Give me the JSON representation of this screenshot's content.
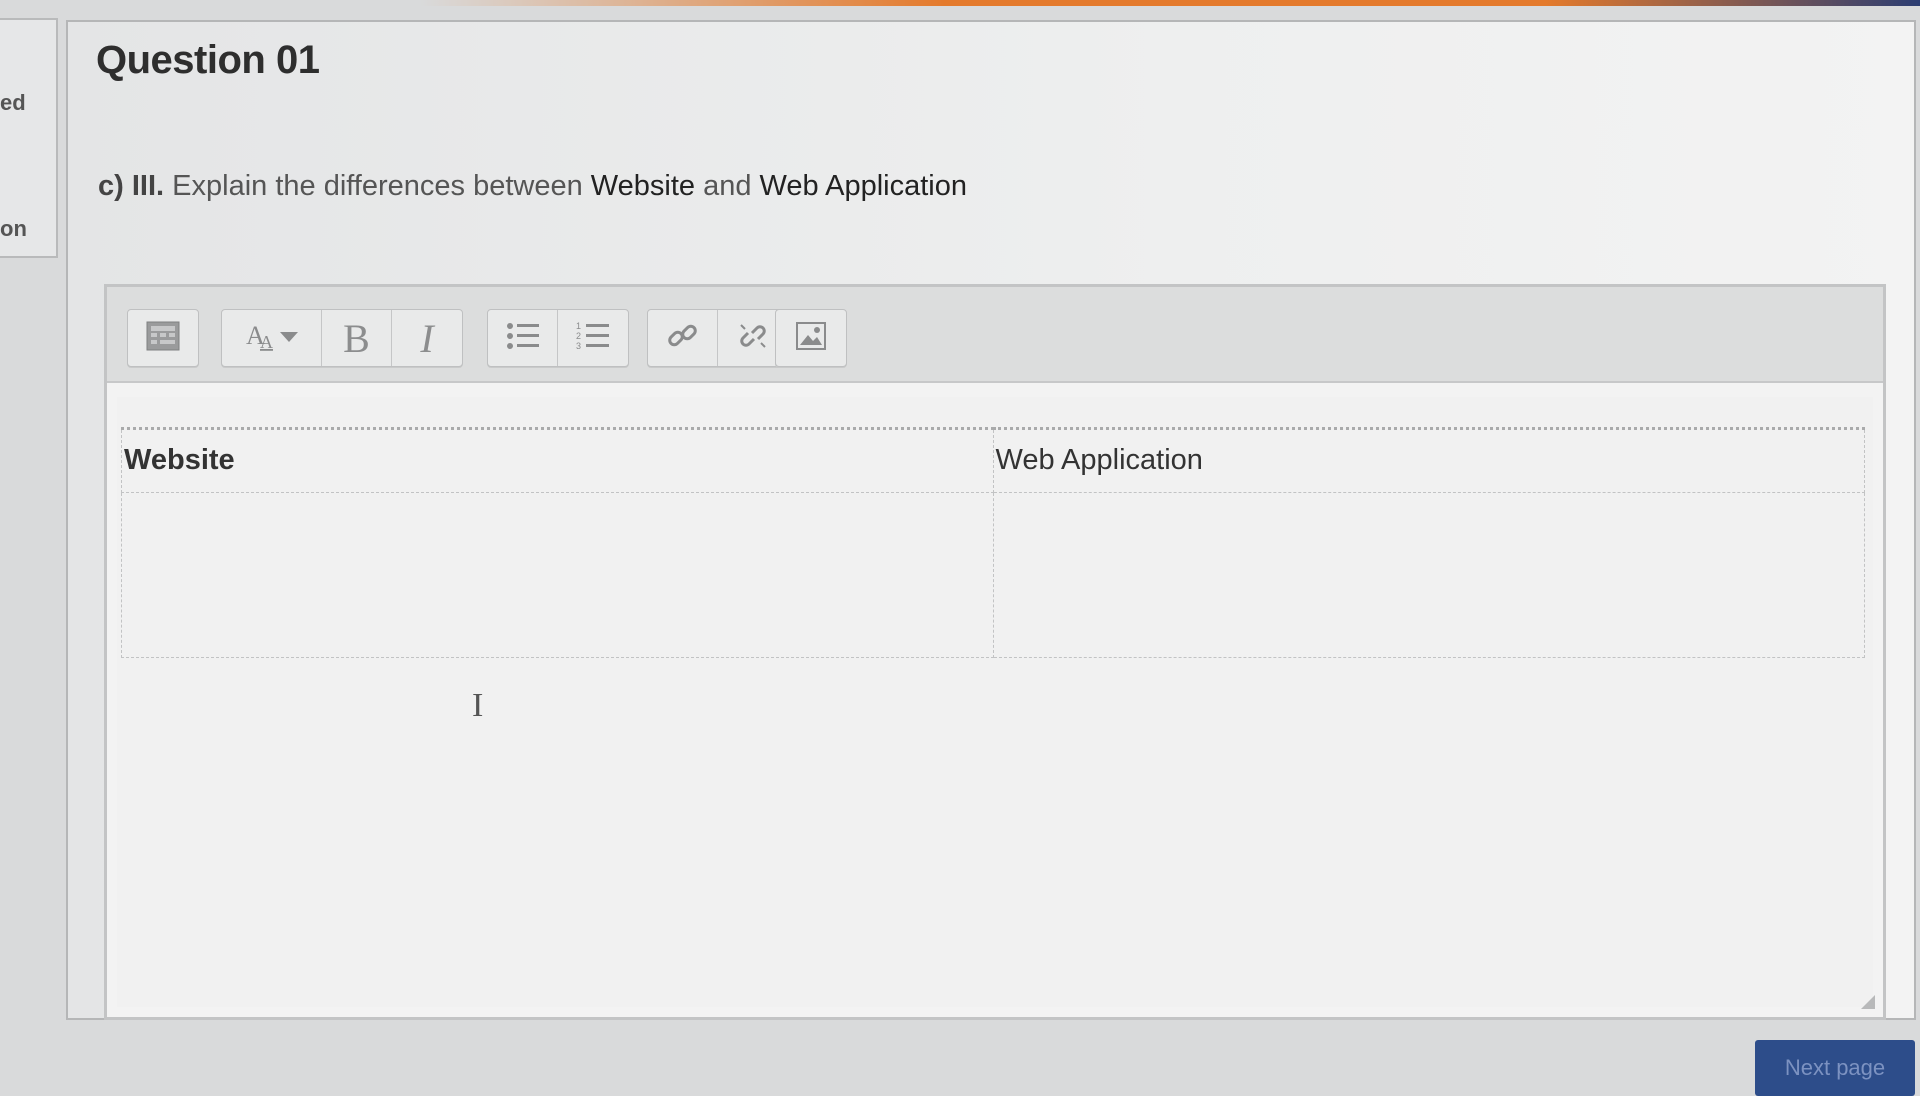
{
  "sidebar": {
    "fragments": [
      "ed",
      "on"
    ]
  },
  "question": {
    "title": "Question 01",
    "part": "c)",
    "subpart": "III.",
    "prompt_text": "Explain the differences between",
    "term1": "Website",
    "joiner": "and",
    "term2": "Web Application"
  },
  "toolbar": {
    "buttons": [
      {
        "name": "toolbar-toggle",
        "icon": "toolbar-toggle-icon"
      },
      {
        "name": "paragraph-styles",
        "icon": "font-size-icon",
        "label": "A"
      },
      {
        "name": "bold",
        "icon": "bold-icon",
        "label": "B"
      },
      {
        "name": "italic",
        "icon": "italic-icon",
        "label": "I"
      },
      {
        "name": "unordered-list",
        "icon": "bullet-list-icon"
      },
      {
        "name": "ordered-list",
        "icon": "numbered-list-icon"
      },
      {
        "name": "link",
        "icon": "link-icon"
      },
      {
        "name": "unlink",
        "icon": "unlink-icon"
      },
      {
        "name": "insert-image",
        "icon": "image-icon"
      }
    ]
  },
  "answer_table": {
    "headers": [
      "Website",
      "Web Application"
    ],
    "rows": [
      [
        "",
        ""
      ]
    ]
  },
  "footer": {
    "next_label": "Next page"
  },
  "colors": {
    "accent_orange": "#e47a2c",
    "nav_blue": "#2d4d8a"
  }
}
